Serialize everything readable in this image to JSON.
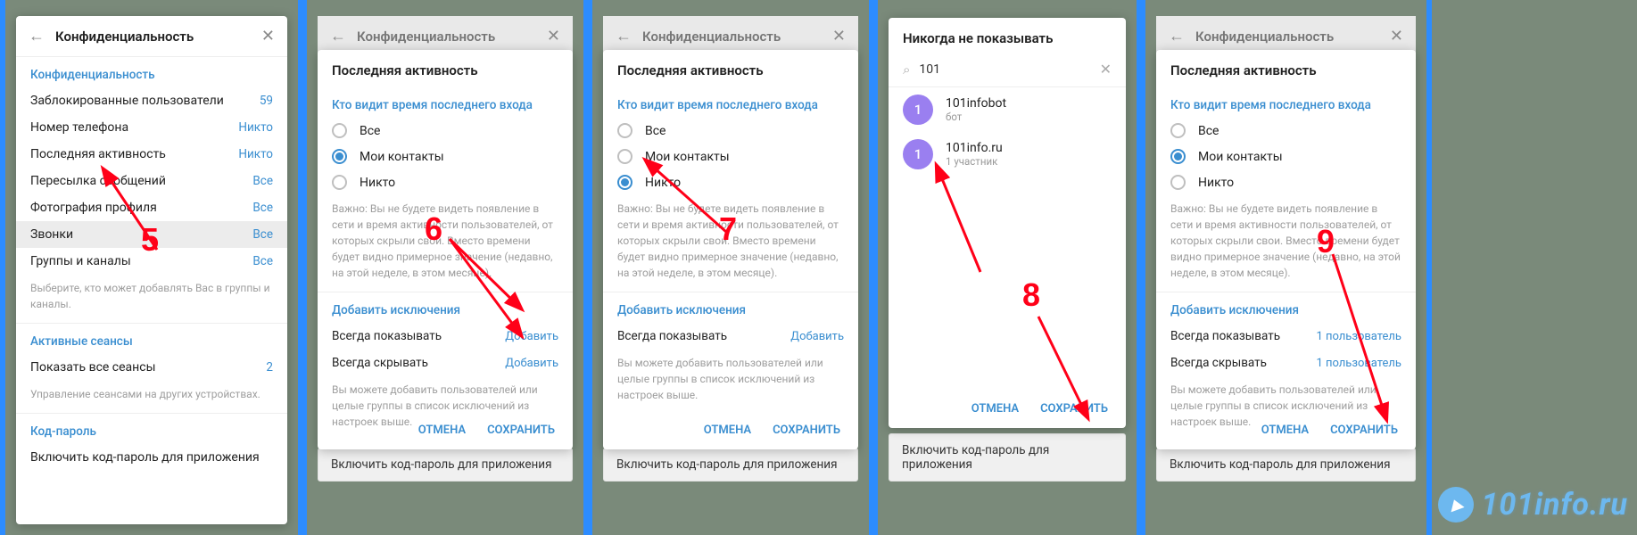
{
  "panel1": {
    "title": "Конфиденциальность",
    "sec1": "Конфиденциальность",
    "rows": [
      {
        "label": "Заблокированные пользователи",
        "value": "59"
      },
      {
        "label": "Номер телефона",
        "value": "Никто"
      },
      {
        "label": "Последняя активность",
        "value": "Никто"
      },
      {
        "label": "Пересылка сообщений",
        "value": "Все"
      },
      {
        "label": "Фотография профиля",
        "value": "Все"
      },
      {
        "label": "Звонки",
        "value": "Все"
      },
      {
        "label": "Группы и каналы",
        "value": "Все"
      }
    ],
    "hint1": "Выберите, кто может добавлять Вас в группы и каналы.",
    "sec2": "Активные сеансы",
    "row2": {
      "label": "Показать все сеансы",
      "value": "2"
    },
    "hint2": "Управление сеансами на других устройствах.",
    "sec3": "Код-пароль",
    "row3": "Включить код-пароль для приложения"
  },
  "activity": {
    "parent_title": "Конфиденциальность",
    "title": "Последняя активность",
    "sec": "Кто видит время последнего входа",
    "opts": [
      "Все",
      "Мои контакты",
      "Никто"
    ],
    "hint": "Важно: Вы не будете видеть появление в сети и время активности пользователей, от которых скрыли свои. Вместо времени будет видно примерное значение (недавно, на этой неделе, в этом месяце).",
    "ex_sec": "Добавить исключения",
    "ex_always": "Всегда показывать",
    "ex_hide": "Всегда скрывать",
    "ex_add": "Добавить",
    "ex_user": "1 пользователь",
    "ex_hint": "Вы можете добавить пользователей или целые группы в список исключений из настроек выше.",
    "cancel": "ОТМЕНА",
    "save": "СОХРАНИТЬ",
    "behind": "Включить код-пароль для приложения"
  },
  "panel4": {
    "title": "Никогда не показывать",
    "search": "101",
    "r1": {
      "name": "101infobot",
      "sub": "бот"
    },
    "r2": {
      "name": "101info.ru",
      "sub": "1 участник"
    },
    "cancel": "ОТМЕНА",
    "save": "СОХРАНИТЬ",
    "behind": "Включить код-пароль для приложения"
  },
  "annotations": {
    "n5": "5",
    "n6": "6",
    "n7": "7",
    "n8": "8",
    "n9": "9"
  },
  "watermark": "101info.ru"
}
